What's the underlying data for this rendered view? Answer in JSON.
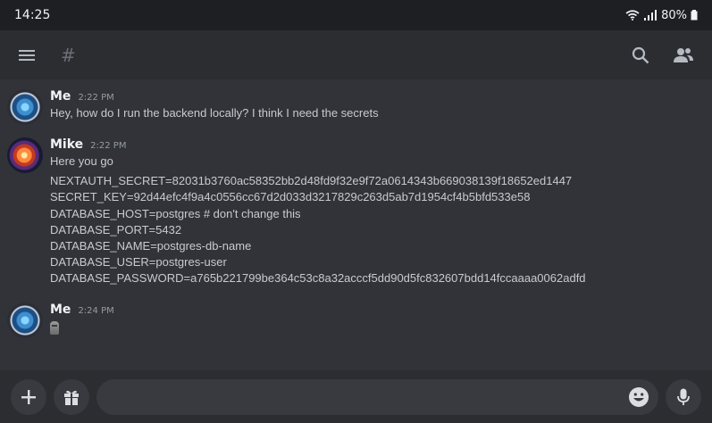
{
  "status_bar": {
    "time": "14:25",
    "battery": "80%"
  },
  "top_bar": {
    "channel_symbol": "#"
  },
  "messages": [
    {
      "author": "Me",
      "time": "2:22 PM",
      "lines": [
        "Hey, how do I run the backend locally? I think I need the secrets"
      ]
    },
    {
      "author": "Mike",
      "time": "2:22 PM",
      "lines": [
        "Here you go",
        "NEXTAUTH_SECRET=82031b3760ac58352bb2d48fd9f32e9f72a0614343b669038139f18652ed1447",
        "SECRET_KEY=92d44efc4f9a4c0556cc67d2d033d3217829c263d5ab7d1954cf4b5bfd533e58",
        "DATABASE_HOST=postgres # don't change this",
        "DATABASE_PORT=5432",
        "DATABASE_NAME=postgres-db-name",
        "DATABASE_USER=postgres-user",
        "DATABASE_PASSWORD=a765b221799be364c53c8a32acccf5dd90d5fc832607bdd14fccaaaa0062adfd"
      ]
    },
    {
      "author": "Me",
      "time": "2:24 PM",
      "emoji": "moai-emoji"
    }
  ],
  "composer": {
    "value": "",
    "placeholder": ""
  },
  "colors": {
    "background": "#313338",
    "bar": "#2b2d31",
    "status": "#1e1f22",
    "accent": "#5865f2"
  }
}
